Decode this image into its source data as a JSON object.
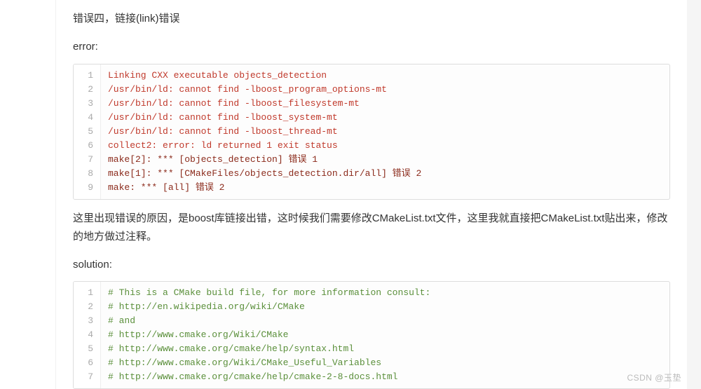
{
  "title_para": "错误四，链接(link)错误",
  "error_label": "error:",
  "code1": {
    "lines": [
      {
        "text": "Linking CXX executable objects_detection",
        "cls": "err-red"
      },
      {
        "text": "/usr/bin/ld: cannot find -lboost_program_options-mt",
        "cls": "err-red"
      },
      {
        "text": "/usr/bin/ld: cannot find -lboost_filesystem-mt",
        "cls": "err-red"
      },
      {
        "text": "/usr/bin/ld: cannot find -lboost_system-mt",
        "cls": "err-red"
      },
      {
        "text": "/usr/bin/ld: cannot find -lboost_thread-mt",
        "cls": "err-red"
      },
      {
        "text": "collect2: error: ld returned 1 exit status",
        "cls": "err-red"
      },
      {
        "text": "make[2]: *** [objects_detection] 错误 1",
        "cls": "err-brown"
      },
      {
        "text": "make[1]: *** [CMakeFiles/objects_detection.dir/all] 错误 2",
        "cls": "err-brown"
      },
      {
        "text": "make: *** [all] 错误 2",
        "cls": "err-brown"
      }
    ]
  },
  "explain_para": "这里出现错误的原因，是boost库链接出错，这时候我们需要修改CMakeList.txt文件，这里我就直接把CMakeList.txt贴出来，修改的地方做过注释。",
  "solution_label": "solution:",
  "code2": {
    "lines": [
      {
        "text": "# This is a CMake build file, for more information consult:",
        "cls": "comment-green"
      },
      {
        "text": "# http://en.wikipedia.org/wiki/CMake",
        "cls": "comment-green"
      },
      {
        "text": "# and",
        "cls": "comment-green"
      },
      {
        "text": "# http://www.cmake.org/Wiki/CMake",
        "cls": "comment-green"
      },
      {
        "text": "# http://www.cmake.org/cmake/help/syntax.html",
        "cls": "comment-green"
      },
      {
        "text": "# http://www.cmake.org/Wiki/CMake_Useful_Variables",
        "cls": "comment-green"
      },
      {
        "text": "# http://www.cmake.org/cmake/help/cmake-2-8-docs.html",
        "cls": "comment-green"
      }
    ]
  },
  "watermark": "CSDN @玉垫"
}
